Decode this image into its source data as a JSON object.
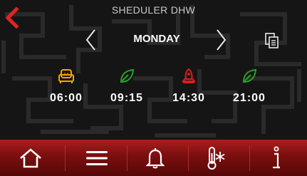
{
  "header": {
    "title": "SHEDULER DHW",
    "back_icon": "back-chevron-icon"
  },
  "day_selector": {
    "day": "MONDAY",
    "prev_icon": "chevron-left-icon",
    "next_icon": "chevron-right-icon",
    "copy_icon": "copy-document-icon"
  },
  "schedule": [
    {
      "time": "06:00",
      "icon": "armchair-comfort-icon",
      "color": "#f5a300"
    },
    {
      "time": "09:15",
      "icon": "leaf-eco-icon",
      "color": "#2aa02a"
    },
    {
      "time": "14:30",
      "icon": "rocket-boost-icon",
      "color": "#e01b1b"
    },
    {
      "time": "21:00",
      "icon": "leaf-eco-icon",
      "color": "#2aa02a"
    }
  ],
  "bottom_nav": [
    {
      "icon": "home-icon"
    },
    {
      "icon": "menu-icon"
    },
    {
      "icon": "bell-icon"
    },
    {
      "icon": "thermometer-snowflake-icon"
    },
    {
      "icon": "info-icon"
    }
  ],
  "colors": {
    "accent": "#d42020",
    "background": "#151515",
    "bar": "#8a1414"
  }
}
